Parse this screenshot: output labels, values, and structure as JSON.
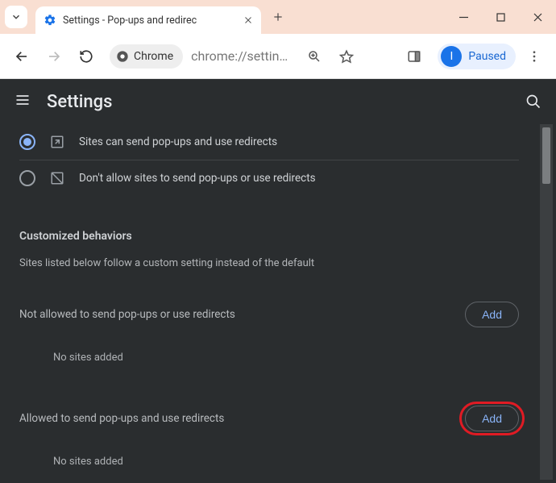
{
  "tab": {
    "title": "Settings - Pop-ups and redirec"
  },
  "toolbar": {
    "chrome_chip": "Chrome",
    "url": "chrome://settin…",
    "paused_label": "Paused",
    "paused_initial": "I"
  },
  "settings": {
    "title": "Settings",
    "radios": {
      "allow": "Sites can send pop-ups and use redirects",
      "block": "Don't allow sites to send pop-ups or use redirects"
    },
    "custom_heading": "Customized behaviors",
    "custom_sub": "Sites listed below follow a custom setting instead of the default",
    "not_allowed_label": "Not allowed to send pop-ups or use redirects",
    "allowed_label": "Allowed to send pop-ups and use redirects",
    "add_label": "Add",
    "empty_text": "No sites added"
  }
}
